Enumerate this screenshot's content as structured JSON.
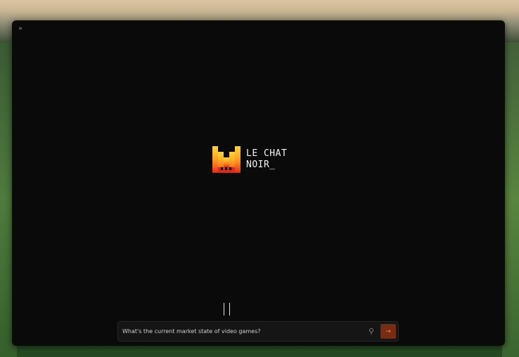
{
  "icons": {
    "sidebar_toggle": "sidebar-toggle-icon",
    "attach": "paperclip-icon",
    "send": "arrow-right-icon",
    "logo": "mistral-logo"
  },
  "brand": {
    "line1": "LE CHAT",
    "line2": "NOIR_"
  },
  "composer": {
    "value": "What's the current market state of video games?",
    "placeholder": ""
  },
  "colors": {
    "window_bg": "#0a0a0a",
    "accent": "#ff8a3d",
    "send_bg": "#7a2c12",
    "logo_top": "#ffd23f",
    "logo_mid": "#ff8a1e",
    "logo_bottom": "#e1261c"
  }
}
